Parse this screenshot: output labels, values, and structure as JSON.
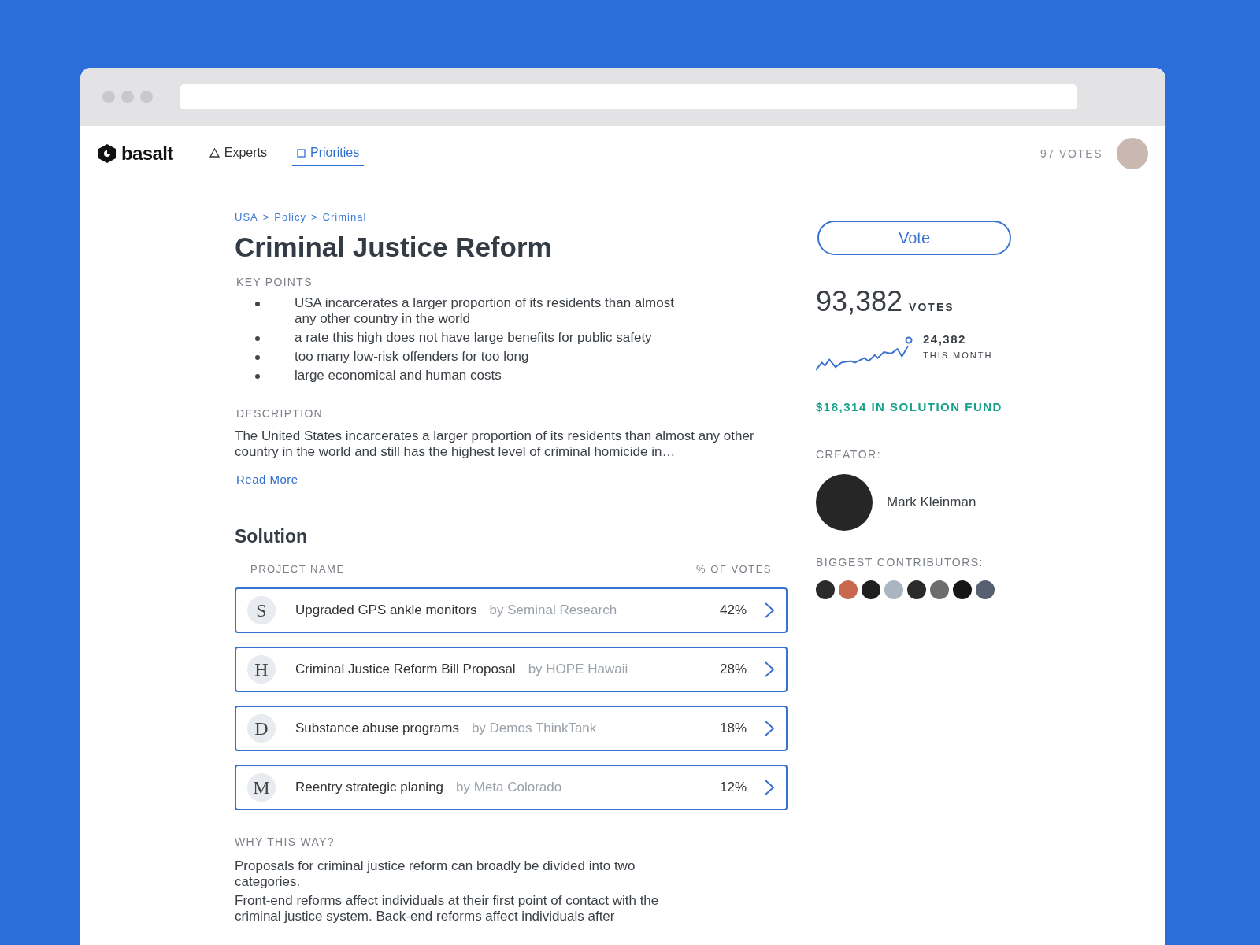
{
  "nav": {
    "logo": "basalt",
    "tabs": [
      {
        "label": "Experts",
        "kind": "triangle",
        "selected": false
      },
      {
        "label": "Priorities",
        "kind": "square",
        "selected": true
      }
    ],
    "votes": "97 VOTES"
  },
  "breadcrumb": [
    "USA",
    ">",
    "Policy",
    ">",
    "Criminal"
  ],
  "title": "Criminal Justice Reform",
  "key_points": {
    "label": "KEY POINTS",
    "items": [
      "USA incarcerates a larger proportion of its residents than almost any other country in the world",
      "a rate this high does not have large benefits for public safety",
      "too many low-risk offenders for too long",
      "large economical and human costs"
    ]
  },
  "description": {
    "label": "DESCRIPTION",
    "text": "The United States incarcerates a larger proportion of its residents than almost any other country in the world and still has the highest level of criminal homicide in…",
    "link": "Read More"
  },
  "solution": {
    "title": "Solution",
    "columns": [
      "PROJECT NAME",
      "% OF VOTES"
    ],
    "rows": [
      {
        "initial": "S",
        "name": "Upgraded GPS ankle monitors",
        "by": "by Seminal Research",
        "percent": "42%"
      },
      {
        "initial": "H",
        "name": "Criminal Justice Reform Bill Proposal",
        "by": "by HOPE Hawaii",
        "percent": "28%"
      },
      {
        "initial": "D",
        "name": "Substance abuse programs",
        "by": "by Demos ThinkTank",
        "percent": "18%"
      },
      {
        "initial": "M",
        "name": "Reentry strategic planing",
        "by": "by Meta Colorado",
        "percent": "12%"
      }
    ]
  },
  "why": {
    "label": "WHY THIS WAY?",
    "paragraphs": [
      "Proposals for criminal justice reform can broadly be divided into two categories.",
      "Front-end reforms affect individuals at their first point of contact with the criminal justice system. Back-end reforms affect individuals after"
    ]
  },
  "sidebar": {
    "vote_button": "Vote",
    "votes": "93,382",
    "votes_label": "VOTES",
    "month_count": "24,382",
    "month_label": "THIS MONTH",
    "fund": "$18,314 IN SOLUTION FUND",
    "creator_label": "CREATOR:",
    "creator": "Mark Kleinman",
    "contributors_label": "BIGGEST CONTRIBUTORS:"
  }
}
